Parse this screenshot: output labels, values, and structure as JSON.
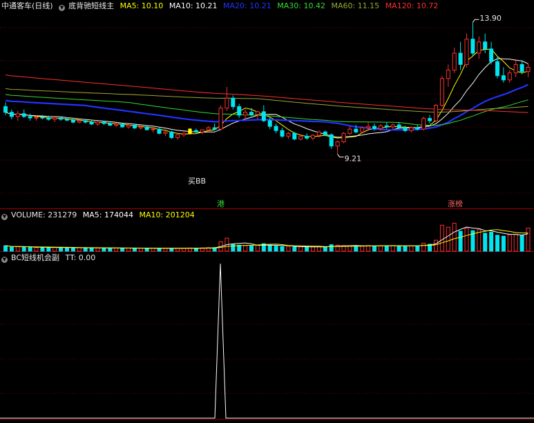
{
  "price_header": {
    "stock_name": "中通客车(日线)",
    "indicator_name": "底背驰短线主",
    "ma": [
      {
        "label": "MA5: 10.10",
        "color": "#ffff00"
      },
      {
        "label": "MA10: 10.21",
        "color": "#ffffff"
      },
      {
        "label": "MA20: 10.21",
        "color": "#2233ff"
      },
      {
        "label": "MA30: 10.42",
        "color": "#33dd33"
      },
      {
        "label": "MA60: 11.15",
        "color": "#99aa33"
      },
      {
        "label": "MA120: 10.72",
        "color": "#ff3030"
      }
    ]
  },
  "volume_header": {
    "label": "VOLUME: 231279",
    "ma": [
      {
        "label": "MA5: 174044",
        "color": "#ffffff"
      },
      {
        "label": "MA10: 201204",
        "color": "#ffff00"
      }
    ]
  },
  "indicator_header": {
    "label": "BC短线机会副",
    "value": "TT: 0.00"
  },
  "annotations": {
    "high_label": "13.90",
    "low_label": "9.21",
    "signal_label": "买BB",
    "tag1": "港",
    "tag2": "涨榜"
  },
  "colors": {
    "up": "#ff3030",
    "down": "#00e5ee",
    "grid": "#8b0000",
    "background": "#000000"
  },
  "chart_data": [
    {
      "type": "candlestick",
      "title": "中通客车(日线)",
      "ohlc": [
        [
          10.9,
          11.05,
          10.6,
          10.7
        ],
        [
          10.7,
          10.8,
          10.45,
          10.55
        ],
        [
          10.55,
          10.75,
          10.4,
          10.65
        ],
        [
          10.65,
          10.8,
          10.5,
          10.55
        ],
        [
          10.55,
          10.65,
          10.4,
          10.5
        ],
        [
          10.5,
          10.6,
          10.4,
          10.52
        ],
        [
          10.52,
          10.6,
          10.45,
          10.5
        ],
        [
          10.5,
          10.58,
          10.4,
          10.45
        ],
        [
          10.45,
          10.55,
          10.35,
          10.5
        ],
        [
          10.5,
          10.55,
          10.4,
          10.45
        ],
        [
          10.45,
          10.52,
          10.38,
          10.42
        ],
        [
          10.42,
          10.5,
          10.3,
          10.35
        ],
        [
          10.35,
          10.45,
          10.3,
          10.4
        ],
        [
          10.4,
          10.45,
          10.3,
          10.35
        ],
        [
          10.35,
          10.42,
          10.25,
          10.28
        ],
        [
          10.28,
          10.38,
          10.22,
          10.35
        ],
        [
          10.35,
          10.4,
          10.25,
          10.3
        ],
        [
          10.3,
          10.36,
          10.2,
          10.24
        ],
        [
          10.24,
          10.32,
          10.18,
          10.28
        ],
        [
          10.28,
          10.32,
          10.15,
          10.18
        ],
        [
          10.18,
          10.28,
          10.12,
          10.24
        ],
        [
          10.24,
          10.28,
          10.1,
          10.14
        ],
        [
          10.14,
          10.22,
          10.08,
          10.18
        ],
        [
          10.18,
          10.22,
          10.05,
          10.08
        ],
        [
          10.08,
          10.15,
          9.98,
          10.1
        ],
        [
          10.1,
          10.14,
          9.92,
          9.95
        ],
        [
          9.95,
          10.05,
          9.85,
          10.0
        ],
        [
          10.0,
          10.05,
          9.75,
          9.8
        ],
        [
          9.8,
          9.95,
          9.72,
          9.9
        ],
        [
          9.9,
          10.0,
          9.82,
          9.95
        ],
        [
          9.95,
          10.1,
          9.9,
          10.05
        ],
        [
          10.05,
          10.12,
          9.95,
          10.0
        ],
        [
          10.0,
          10.1,
          9.92,
          10.08
        ],
        [
          10.08,
          10.2,
          10.0,
          10.15
        ],
        [
          10.15,
          10.3,
          10.05,
          10.1
        ],
        [
          10.1,
          10.95,
          10.05,
          10.85
        ],
        [
          10.85,
          11.6,
          10.75,
          11.2
        ],
        [
          11.2,
          11.3,
          10.8,
          10.9
        ],
        [
          10.9,
          11.0,
          10.5,
          10.6
        ],
        [
          10.6,
          10.8,
          10.45,
          10.7
        ],
        [
          10.7,
          10.85,
          10.55,
          10.62
        ],
        [
          10.62,
          10.75,
          10.45,
          10.72
        ],
        [
          10.72,
          10.95,
          10.35,
          10.4
        ],
        [
          10.4,
          10.5,
          10.1,
          10.2
        ],
        [
          10.2,
          10.3,
          9.95,
          10.05
        ],
        [
          10.05,
          10.15,
          9.8,
          9.85
        ],
        [
          9.85,
          10.0,
          9.75,
          9.95
        ],
        [
          9.95,
          10.0,
          9.7,
          9.75
        ],
        [
          9.75,
          9.9,
          9.7,
          9.85
        ],
        [
          9.85,
          9.95,
          9.72,
          9.78
        ],
        [
          9.78,
          9.92,
          9.7,
          9.88
        ],
        [
          9.88,
          10.05,
          9.8,
          10.0
        ],
        [
          10.0,
          10.05,
          9.85,
          9.9
        ],
        [
          9.9,
          9.95,
          9.4,
          9.5
        ],
        [
          9.5,
          9.7,
          9.21,
          9.65
        ],
        [
          9.65,
          10.0,
          9.6,
          9.95
        ],
        [
          9.95,
          10.2,
          9.9,
          10.1
        ],
        [
          10.1,
          10.25,
          9.95,
          10.0
        ],
        [
          10.0,
          10.2,
          9.95,
          10.15
        ],
        [
          10.15,
          10.35,
          10.05,
          10.2
        ],
        [
          10.2,
          10.3,
          10.05,
          10.12
        ],
        [
          10.12,
          10.28,
          10.05,
          10.22
        ],
        [
          10.22,
          10.35,
          10.1,
          10.18
        ],
        [
          10.18,
          10.3,
          10.1,
          10.25
        ],
        [
          10.25,
          10.35,
          10.1,
          10.15
        ],
        [
          10.15,
          10.22,
          10.0,
          10.05
        ],
        [
          10.05,
          10.2,
          9.98,
          10.15
        ],
        [
          10.15,
          10.25,
          10.05,
          10.1
        ],
        [
          10.1,
          10.55,
          10.05,
          10.48
        ],
        [
          10.48,
          10.6,
          10.3,
          10.4
        ],
        [
          10.4,
          11.0,
          10.35,
          10.95
        ],
        [
          10.95,
          12.0,
          10.9,
          11.9
        ],
        [
          11.9,
          12.4,
          11.6,
          12.2
        ],
        [
          12.2,
          13.0,
          12.1,
          12.8
        ],
        [
          12.8,
          13.2,
          12.2,
          12.4
        ],
        [
          12.4,
          13.5,
          12.3,
          13.3
        ],
        [
          13.3,
          13.9,
          12.7,
          12.8
        ],
        [
          12.8,
          13.4,
          12.6,
          13.2
        ],
        [
          13.2,
          13.5,
          12.8,
          12.95
        ],
        [
          12.95,
          13.2,
          12.4,
          12.5
        ],
        [
          12.5,
          12.7,
          11.9,
          12.0
        ],
        [
          12.0,
          12.3,
          11.75,
          11.85
        ],
        [
          11.85,
          12.2,
          11.75,
          12.1
        ],
        [
          12.1,
          12.6,
          11.95,
          12.4
        ],
        [
          12.4,
          12.55,
          12.05,
          12.15
        ],
        [
          12.15,
          12.45,
          11.95,
          12.3
        ]
      ],
      "ma5": [
        10.1
      ],
      "ma10": [
        10.21
      ],
      "ma20": [
        10.21
      ],
      "ma30": [
        10.42
      ],
      "ma60": [
        11.15
      ],
      "ma120": [
        10.72
      ],
      "high_point": 13.9,
      "low_point": 9.21
    },
    {
      "type": "bar",
      "title": "VOLUME",
      "values": [
        55,
        40,
        45,
        42,
        38,
        36,
        40,
        35,
        38,
        34,
        36,
        33,
        35,
        32,
        34,
        31,
        33,
        30,
        32,
        30,
        31,
        29,
        30,
        28,
        30,
        29,
        30,
        27,
        28,
        30,
        32,
        31,
        33,
        35,
        36,
        95,
        130,
        70,
        60,
        55,
        52,
        58,
        75,
        60,
        50,
        45,
        48,
        42,
        44,
        41,
        43,
        46,
        40,
        65,
        60,
        55,
        52,
        50,
        54,
        56,
        52,
        55,
        53,
        57,
        55,
        50,
        54,
        52,
        80,
        70,
        110,
        260,
        240,
        280,
        200,
        230,
        205,
        215,
        180,
        190,
        160,
        150,
        165,
        170,
        158,
        231.279
      ],
      "ma5_last": 174044,
      "ma10_last": 201204
    },
    {
      "type": "line",
      "title": "BC短线机会副",
      "series": [
        {
          "name": "TT",
          "peak_index": 35,
          "peak_value": 1,
          "baseline": 0
        }
      ],
      "current_value": 0.0
    }
  ]
}
